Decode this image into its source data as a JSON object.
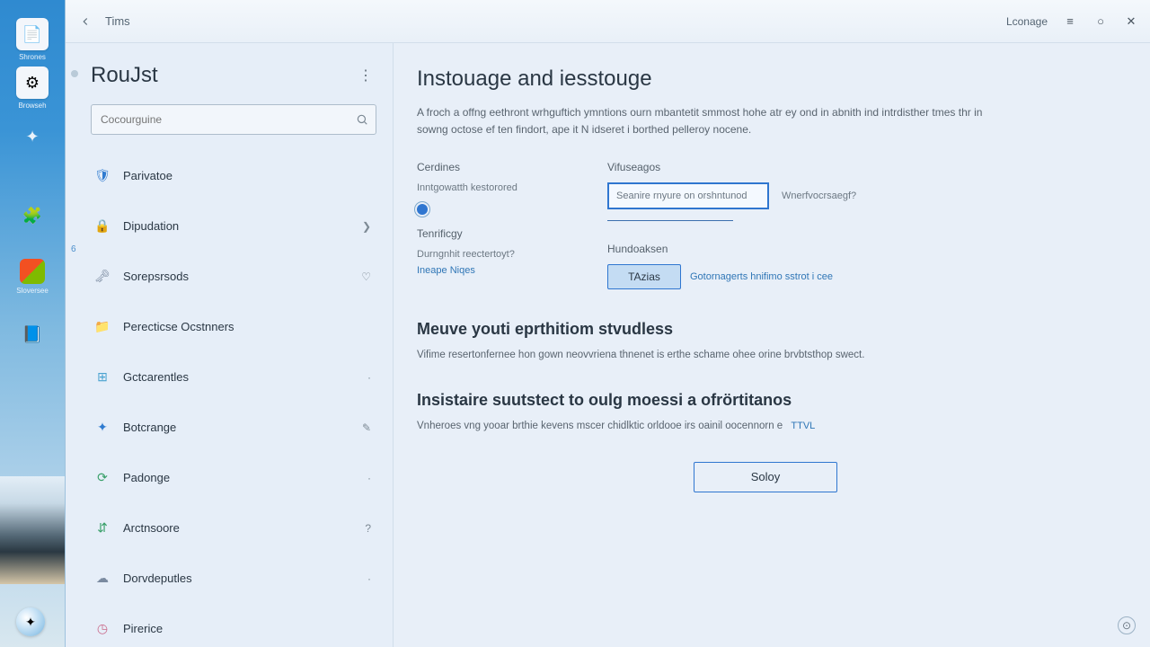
{
  "taskbar": {
    "items": [
      {
        "label": "Shrones",
        "glyph": "📄",
        "bg": "white"
      },
      {
        "label": "Browseh",
        "glyph": "⚙",
        "bg": "white"
      },
      {
        "label": "",
        "glyph": "✦",
        "bg": ""
      },
      {
        "label": "",
        "glyph": "🧩",
        "bg": ""
      },
      {
        "label": "Sloversee",
        "glyph": "🟦",
        "bg": ""
      },
      {
        "label": "",
        "glyph": "📘",
        "bg": ""
      }
    ]
  },
  "titlebar": {
    "back": "‹",
    "title": "Tims",
    "language": "Lconage"
  },
  "sidepanel": {
    "title": "RouJst",
    "search_placeholder": "Cocourguine",
    "gutter_digit": "6",
    "items": [
      {
        "icon": "🛡",
        "color": "#2f7bd0",
        "label": "Parivatoe",
        "chevron": ""
      },
      {
        "icon": "🔒",
        "color": "#c98a3a",
        "label": "Dipudation",
        "chevron": "❯"
      },
      {
        "icon": "🗝",
        "color": "#7a8aa0",
        "label": "Sorepsrsods",
        "chevron": "♡"
      },
      {
        "icon": "📁",
        "color": "#d08a3a",
        "label": "Perecticse Ocstnners",
        "chevron": ""
      },
      {
        "icon": "⊞",
        "color": "#4aa3d0",
        "label": "Gctcarentles",
        "chevron": "·"
      },
      {
        "icon": "✦",
        "color": "#2f7bd0",
        "label": "Botcrange",
        "chevron": "✎"
      },
      {
        "icon": "⟳",
        "color": "#3aa06a",
        "label": "Padonge",
        "chevron": "·"
      },
      {
        "icon": "⇵",
        "color": "#3aa06a",
        "label": "Arctnsoore",
        "chevron": "?"
      },
      {
        "icon": "☁",
        "color": "#7a8aa0",
        "label": "Dorvdeputles",
        "chevron": "·"
      },
      {
        "icon": "◷",
        "color": "#c96a8a",
        "label": "Pirerice",
        "chevron": ""
      }
    ]
  },
  "content": {
    "title": "Instouage and iesstouge",
    "desc": "A froch a offng eethront wrhguftich ymntions ourn mbantetit smmost hohe atr ey ond in abnith ind intrdisther tmes thr in sowng octose ef ten findort, ape it N idseret i borthed pelleroy nocene.",
    "left_col": {
      "label": "Cerdines",
      "sub": "Inntgowatth kestorored",
      "term_label": "Tenrificgy",
      "term_sub": "Durngnhit reectertoyt?",
      "term_link": "Ineape Niqes"
    },
    "right_col": {
      "label": "Vifuseagos",
      "field_value": "Seanire rnyure on orshntunod",
      "field_hint": "Wnerfvocrsaegf?",
      "hw_label": "Hundoaksen",
      "hw_button": "TAzias",
      "hw_link": "Gotornagerts hnifimo sstrot i cee"
    },
    "section_a": {
      "title": "Meuve youti eprthitiom stvudless",
      "desc": "Vifime resertonfernee hon gown neovvriena thnenet is erthe schame ohee orine brvbtsthop swect."
    },
    "section_b": {
      "title": "Insistaire suutstect to oulg moessi a ofrörtitanos",
      "desc": "Vnheroes vng yooar brthie kevens mscer chidlktic orldooe irs oainil oocennorn e",
      "tag": "TTVL"
    },
    "footer_button": "Soloy"
  }
}
